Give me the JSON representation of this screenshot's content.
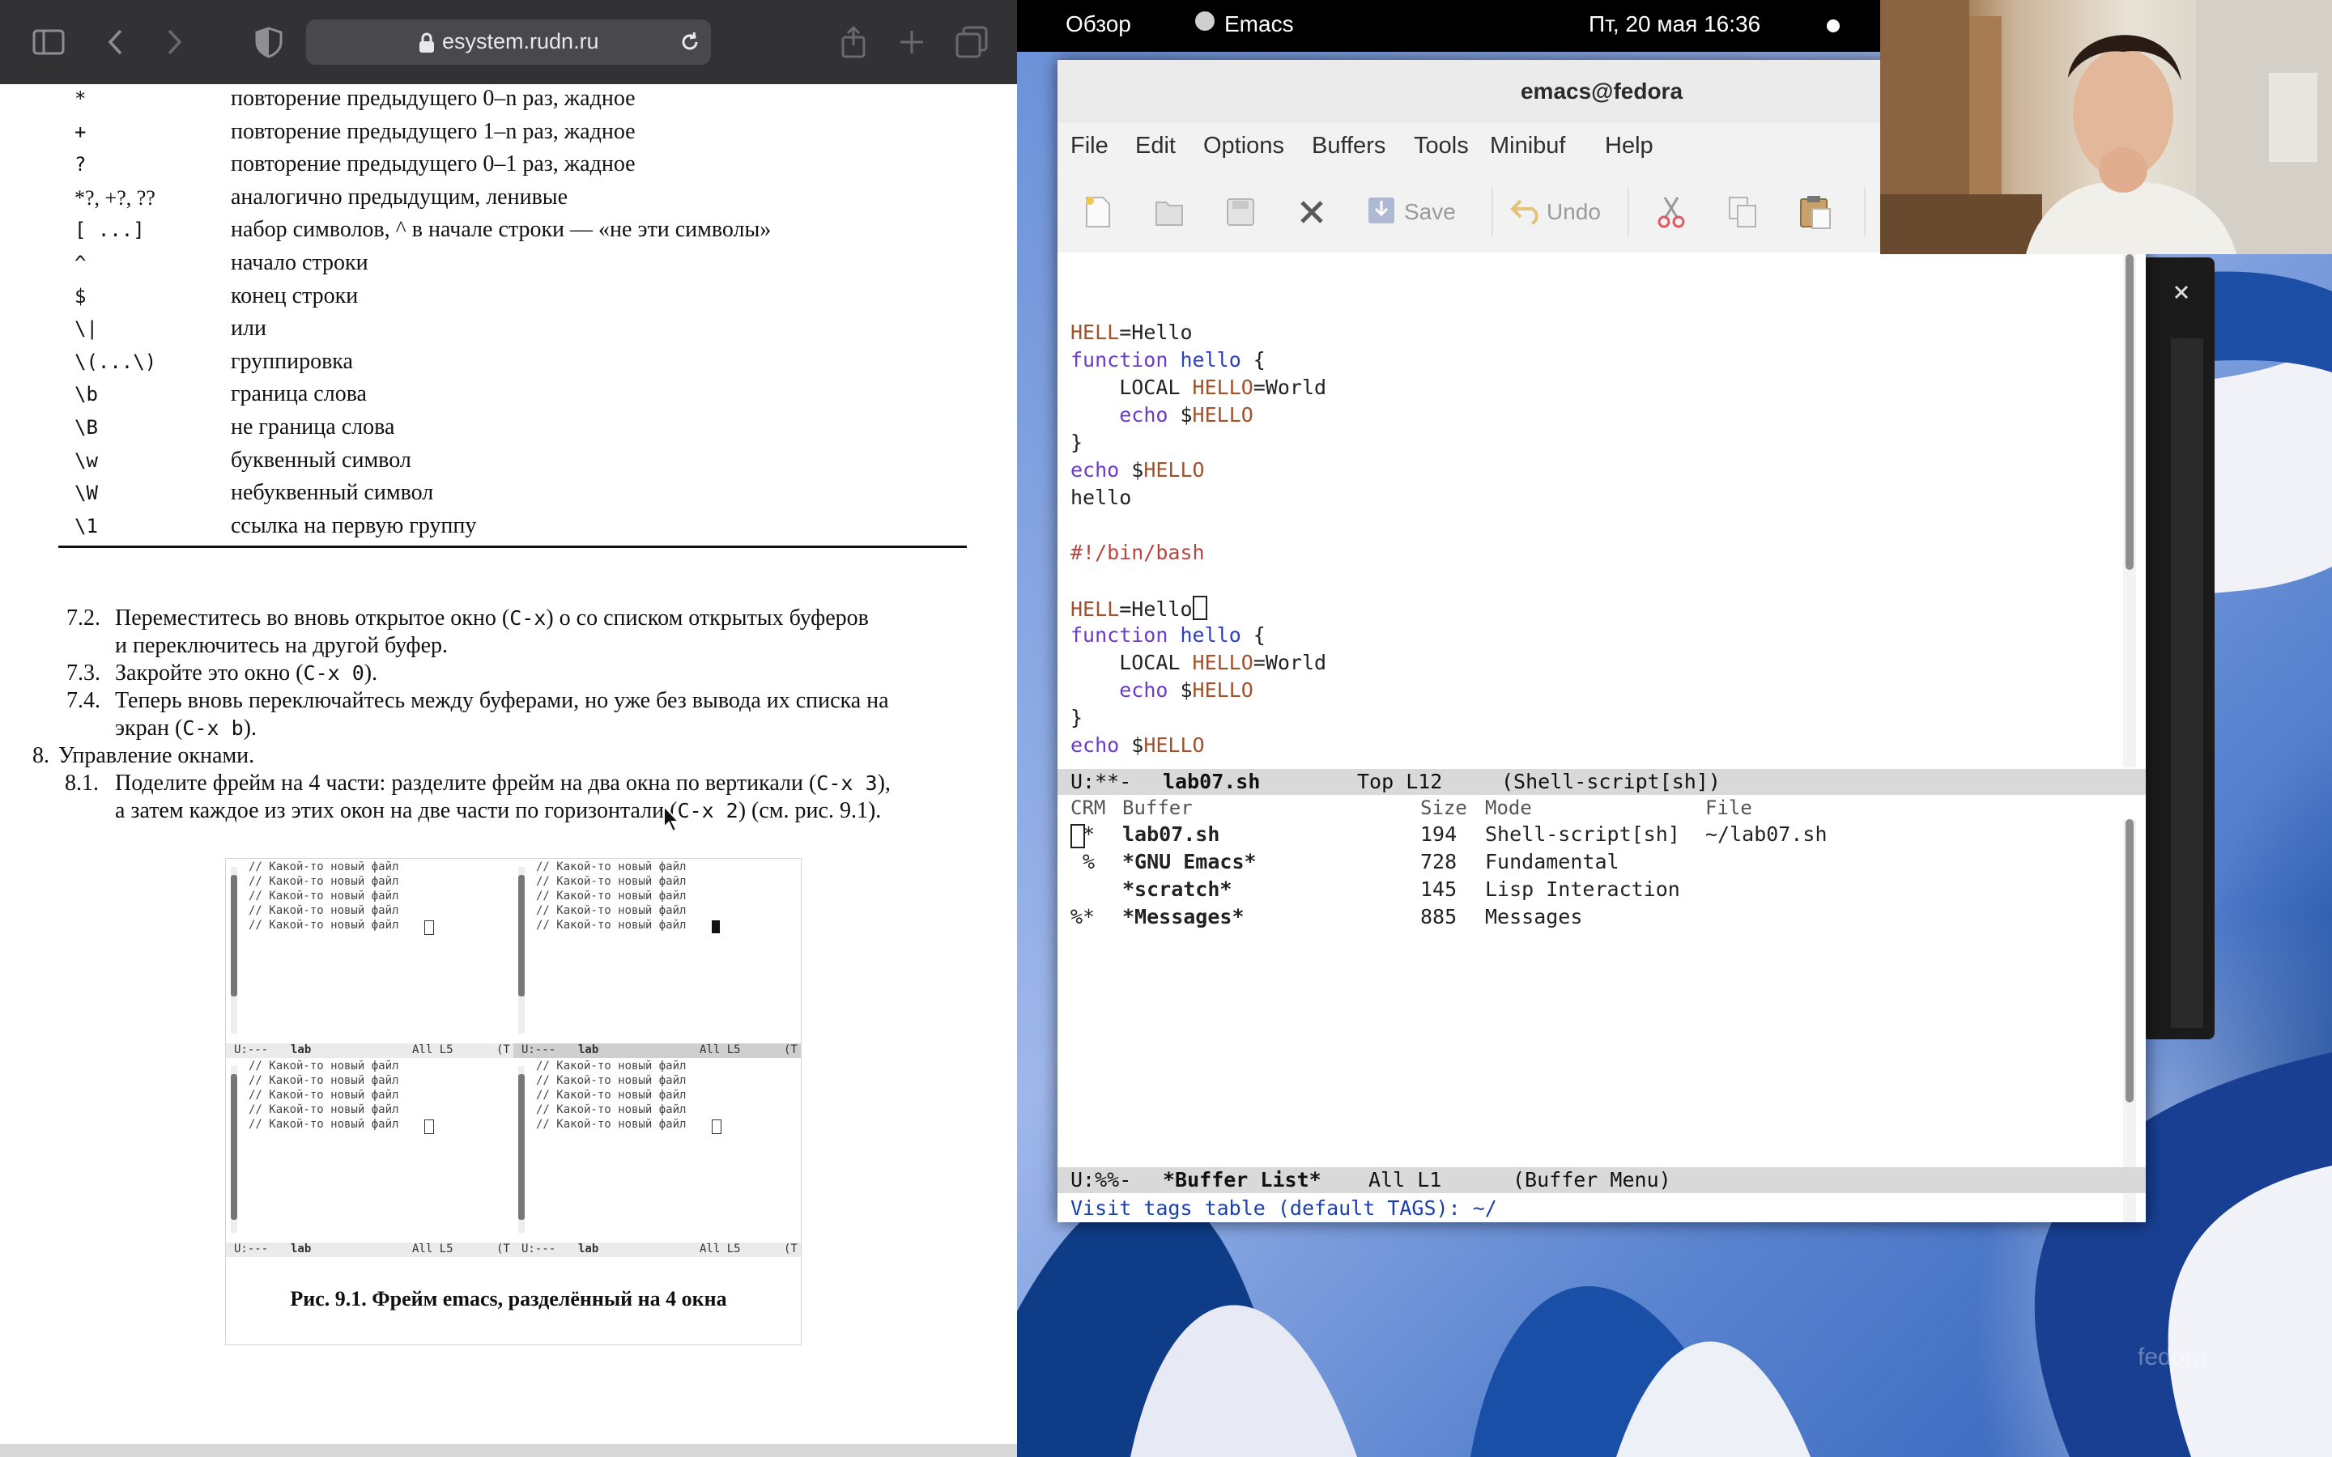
{
  "browser": {
    "url": "esystem.rudn.ru"
  },
  "document": {
    "regex_table": [
      {
        "sym": "*",
        "desc": "повторение предыдущего 0–n раз, жадное"
      },
      {
        "sym": "+",
        "desc": "повторение предыдущего 1–n раз, жадное"
      },
      {
        "sym": "?",
        "desc": "повторение предыдущего 0–1 раз, жадное"
      },
      {
        "sym": "*?, +?, ??",
        "desc": "аналогично предыдущим, ленивые"
      },
      {
        "sym": "[ ...]",
        "desc": "набор символов, ^ в начале строки — «не эти символы»"
      },
      {
        "sym": "^",
        "desc": "начало строки"
      },
      {
        "sym": "$",
        "desc": "конец строки"
      },
      {
        "sym": "\\|",
        "desc": "или"
      },
      {
        "sym": "\\(...\\)",
        "desc": "группировка"
      },
      {
        "sym": "\\b",
        "desc": "граница слова"
      },
      {
        "sym": "\\B",
        "desc": "не граница слова"
      },
      {
        "sym": "\\w",
        "desc": "буквенный символ"
      },
      {
        "sym": "\\W",
        "desc": "небуквенный символ"
      },
      {
        "sym": "\\1",
        "desc": "ссылка на первую группу"
      }
    ],
    "steps": {
      "s72_num": "7.2.",
      "s72_line1a": "Переместитесь во вновь открытое окно (",
      "s72_code": "C-x",
      "s72_line1b": ") о со списком открытых буферов",
      "s72_line2": "и переключитесь на другой буфер.",
      "s73_num": "7.3.",
      "s73_a": "Закройте это окно (",
      "s73_code": "C-x 0",
      "s73_b": ").",
      "s74_num": "7.4.",
      "s74_line1": "Теперь вновь переключайтесь между буферами, но уже без вывода их списка на",
      "s74_line2a": "экран (",
      "s74_code": "C-x b",
      "s74_line2b": ").",
      "s8_num": "8.",
      "s8_text": "Управление окнами.",
      "s81_num": "8.1.",
      "s81_line1a": "Поделите фрейм на 4 части: разделите фрейм на два окна по вертикали (",
      "s81_code1": "C-x 3",
      "s81_line1b": "),",
      "s81_line2a": "а затем каждое из этих окон на две части по горизонтали (",
      "s81_code2": "C-x 2",
      "s81_line2b": ") (см. рис. 9.1)."
    },
    "figure": {
      "pane_line": "// Какой-то новый файл",
      "modeline_status": "U:---",
      "modeline_name": "lab",
      "modeline_pos": "All L5",
      "modeline_tail": "(T",
      "caption": "Рис. 9.1. Фрейм emacs, разделённый на 4 окна"
    }
  },
  "gnome": {
    "activities": "Обзор",
    "app": "Emacs",
    "clock": "Пт, 20 мая  16:36"
  },
  "emacs": {
    "title": "emacs@fedora",
    "menu": [
      "File",
      "Edit",
      "Options",
      "Buffers",
      "Tools",
      "Minibuf",
      "Help"
    ],
    "toolbar": {
      "save": "Save",
      "undo": "Undo"
    },
    "code_lines": [
      [
        {
          "t": "HELL",
          "c": "var"
        },
        {
          "t": "=Hello",
          "c": ""
        }
      ],
      [
        {
          "t": "function",
          "c": "kw"
        },
        {
          "t": " ",
          "c": ""
        },
        {
          "t": "hello",
          "c": "fn"
        },
        {
          "t": " {",
          "c": ""
        }
      ],
      [
        {
          "t": "    LOCAL ",
          "c": ""
        },
        {
          "t": "HELLO",
          "c": "var"
        },
        {
          "t": "=World",
          "c": ""
        }
      ],
      [
        {
          "t": "    ",
          "c": ""
        },
        {
          "t": "echo",
          "c": "kw"
        },
        {
          "t": " $",
          "c": ""
        },
        {
          "t": "HELLO",
          "c": "var"
        }
      ],
      [
        {
          "t": "}",
          "c": ""
        }
      ],
      [
        {
          "t": "echo",
          "c": "kw"
        },
        {
          "t": " $",
          "c": ""
        },
        {
          "t": "HELLO",
          "c": "var"
        }
      ],
      [
        {
          "t": "hello",
          "c": ""
        }
      ],
      [
        {
          "t": "",
          "c": ""
        }
      ],
      [
        {
          "t": "#!/bin/bash",
          "c": "cm"
        }
      ],
      [
        {
          "t": "",
          "c": ""
        }
      ],
      [
        {
          "t": "HELL",
          "c": "var"
        },
        {
          "t": "=Hello",
          "c": ""
        }
      ],
      [
        {
          "t": "function",
          "c": "kw"
        },
        {
          "t": " ",
          "c": ""
        },
        {
          "t": "hello",
          "c": "fn"
        },
        {
          "t": " {",
          "c": ""
        }
      ],
      [
        {
          "t": "    LOCAL ",
          "c": ""
        },
        {
          "t": "HELLO",
          "c": "var"
        },
        {
          "t": "=World",
          "c": ""
        }
      ],
      [
        {
          "t": "    ",
          "c": ""
        },
        {
          "t": "echo",
          "c": "kw"
        },
        {
          "t": " $",
          "c": ""
        },
        {
          "t": "HELLO",
          "c": "var"
        }
      ],
      [
        {
          "t": "}",
          "c": ""
        }
      ],
      [
        {
          "t": "echo",
          "c": "kw"
        },
        {
          "t": " $",
          "c": ""
        },
        {
          "t": "HELLO",
          "c": "var"
        }
      ]
    ],
    "modeline_top": {
      "status": "U:**-",
      "buffer": "lab07.sh",
      "pos": "Top L12",
      "mode": "(Shell-script[sh])"
    },
    "buffer_list": {
      "header": {
        "crm": "CRM",
        "buffer": "Buffer",
        "size": "Size",
        "mode": "Mode",
        "file": "File"
      },
      "rows": [
        {
          "crm": " * ",
          "name": "lab07.sh",
          "size": "194",
          "mode": "Shell-script[sh]",
          "file": "~/lab07.sh"
        },
        {
          "crm": " % ",
          "name": "*GNU Emacs*",
          "size": "728",
          "mode": "Fundamental",
          "file": ""
        },
        {
          "crm": "   ",
          "name": "*scratch*",
          "size": "145",
          "mode": "Lisp Interaction",
          "file": ""
        },
        {
          "crm": "%* ",
          "name": "*Messages*",
          "size": "885",
          "mode": "Messages",
          "file": ""
        }
      ]
    },
    "modeline_bottom": {
      "status": "U:%%-",
      "buffer": "*Buffer List*",
      "pos": "All L1",
      "mode": "(Buffer Menu)"
    },
    "minibuffer": "Visit tags table (default TAGS): ~/"
  },
  "watermark": "fedora",
  "colors": {
    "emacs_keyword": "#6b3cc6",
    "emacs_function": "#2b3fbf",
    "emacs_variable": "#a0522d",
    "emacs_comment": "#b8463f",
    "emacs_minibuffer": "#1a3fae"
  }
}
